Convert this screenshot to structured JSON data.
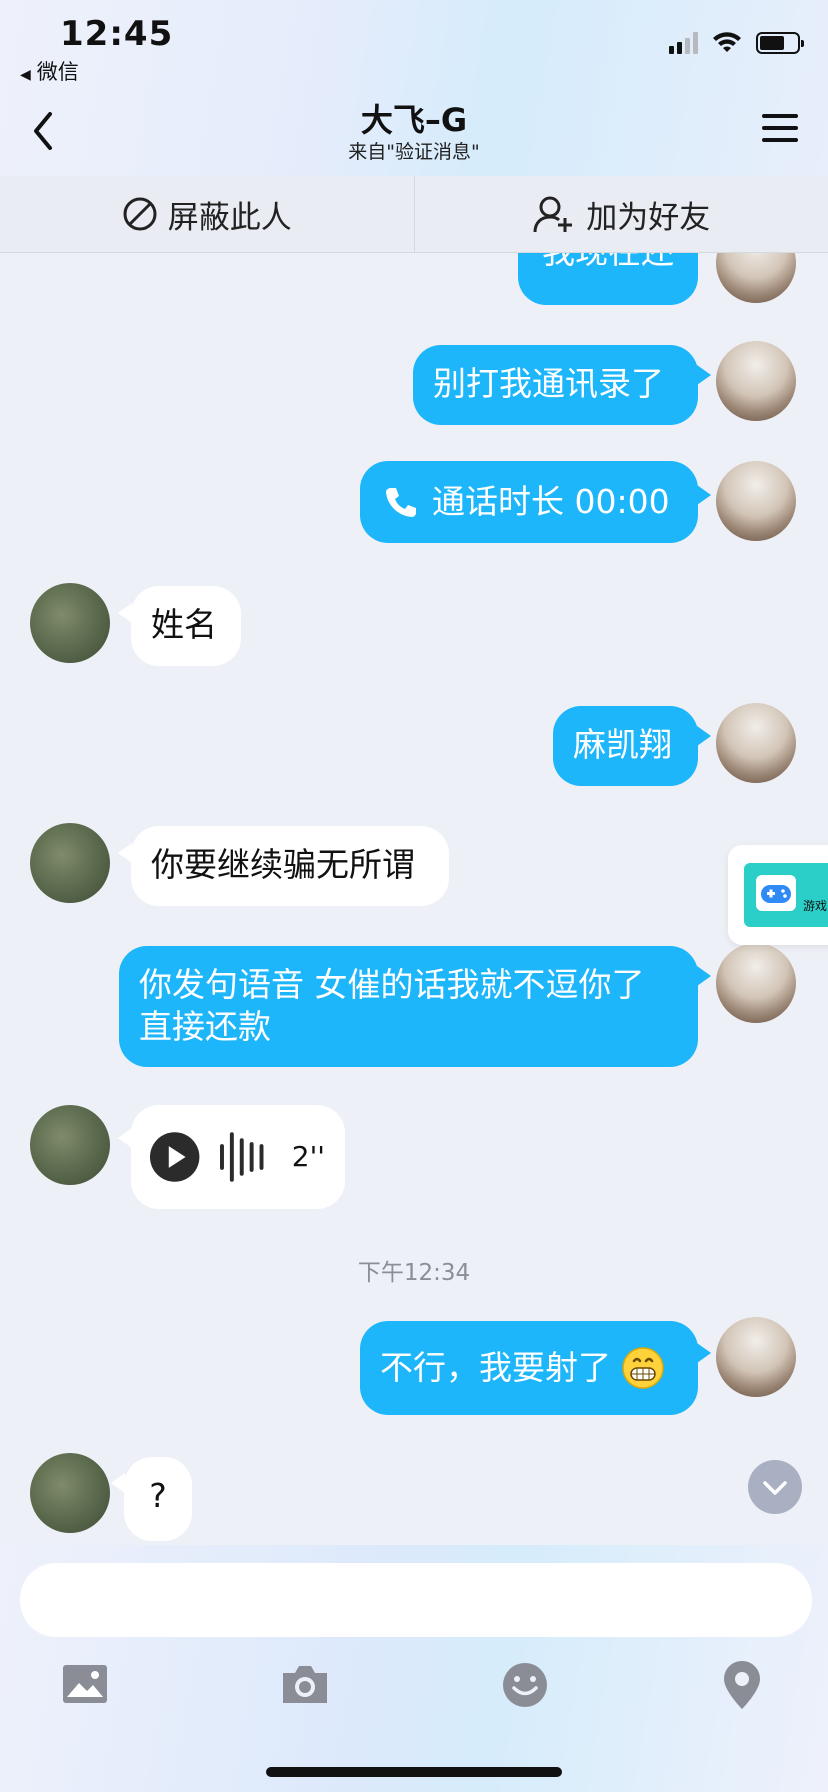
{
  "status_bar": {
    "time": "12:45",
    "back_app": "微信"
  },
  "header": {
    "title": "大飞–G",
    "subtitle": "来自\"验证消息\""
  },
  "actions": {
    "block": "屏蔽此人",
    "add_friend": "加为好友"
  },
  "messages": {
    "m0": "我现在还",
    "m1": "别打我通讯录了",
    "m2": "通话时长 00:00",
    "m3": "姓名",
    "m4": "麻凯翔",
    "m5": "你要继续骗无所谓",
    "m6_line1": "你发句语音 女催的话我就不逗你了",
    "m6_line2": "直接还款",
    "m7_duration": "2''",
    "timestamp": "下午12:34",
    "m8": "不行，我要射了",
    "m9": "?"
  },
  "floating": {
    "label": "游戏"
  },
  "input": {
    "placeholder": ""
  },
  "colors": {
    "outgoing_bubble": "#1eb6fb",
    "incoming_bubble": "#ffffff",
    "accent": "#1eb6fb"
  }
}
